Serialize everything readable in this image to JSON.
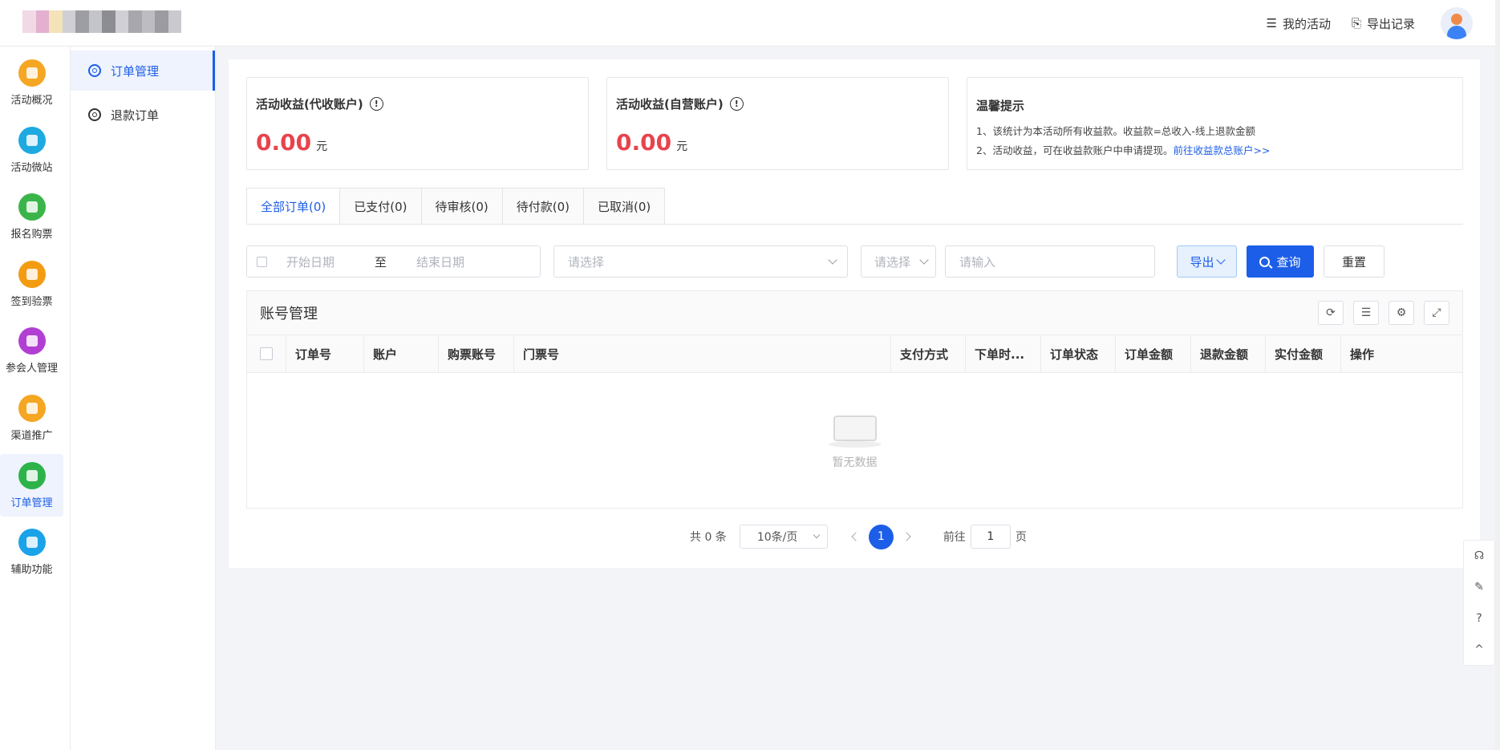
{
  "header": {
    "my_activity": "我的活动",
    "export_records": "导出记录"
  },
  "leftnav": [
    {
      "label": "活动概况",
      "color": "#f5a623"
    },
    {
      "label": "活动微站",
      "color": "#1fa9e1"
    },
    {
      "label": "报名购票",
      "color": "#3bb54a"
    },
    {
      "label": "签到验票",
      "color": "#f39c12"
    },
    {
      "label": "参会人管理",
      "color": "#b23fd3"
    },
    {
      "label": "渠道推广",
      "color": "#f5a623"
    },
    {
      "label": "订单管理",
      "color": "#2db34a"
    },
    {
      "label": "辅助功能",
      "color": "#1aa3e8"
    }
  ],
  "subnav": {
    "orders": "订单管理",
    "refunds": "退款订单"
  },
  "cards": {
    "collect": {
      "title": "活动收益(代收账户)",
      "amount": "0.00",
      "unit": "元"
    },
    "self": {
      "title": "活动收益(自营账户)",
      "amount": "0.00",
      "unit": "元"
    },
    "tips": {
      "title": "温馨提示",
      "line1": "1、该统计为本活动所有收益款。收益款=总收入-线上退款金额",
      "line2": "2、活动收益，可在收益款账户中申请提现。",
      "link": "前往收益款总账户>>"
    }
  },
  "tabs": [
    "全部订单(0)",
    "已支付(0)",
    "待审核(0)",
    "待付款(0)",
    "已取消(0)"
  ],
  "filters": {
    "start_date": "开始日期",
    "to": "至",
    "end_date": "结束日期",
    "select1": "请选择",
    "select2": "请选择",
    "input": "请输入",
    "export": "导出",
    "query": "查询",
    "reset": "重置"
  },
  "table": {
    "title": "账号管理",
    "columns": [
      "订单号",
      "账户",
      "购票账号",
      "门票号",
      "支付方式",
      "下单时...",
      "订单状态",
      "订单金额",
      "退款金额",
      "实付金额",
      "操作"
    ],
    "empty": "暂无数据"
  },
  "pager": {
    "total": "共 0 条",
    "page_size": "10条/页",
    "current": "1",
    "goto": "前往",
    "goto_value": "1",
    "page_unit": "页"
  }
}
